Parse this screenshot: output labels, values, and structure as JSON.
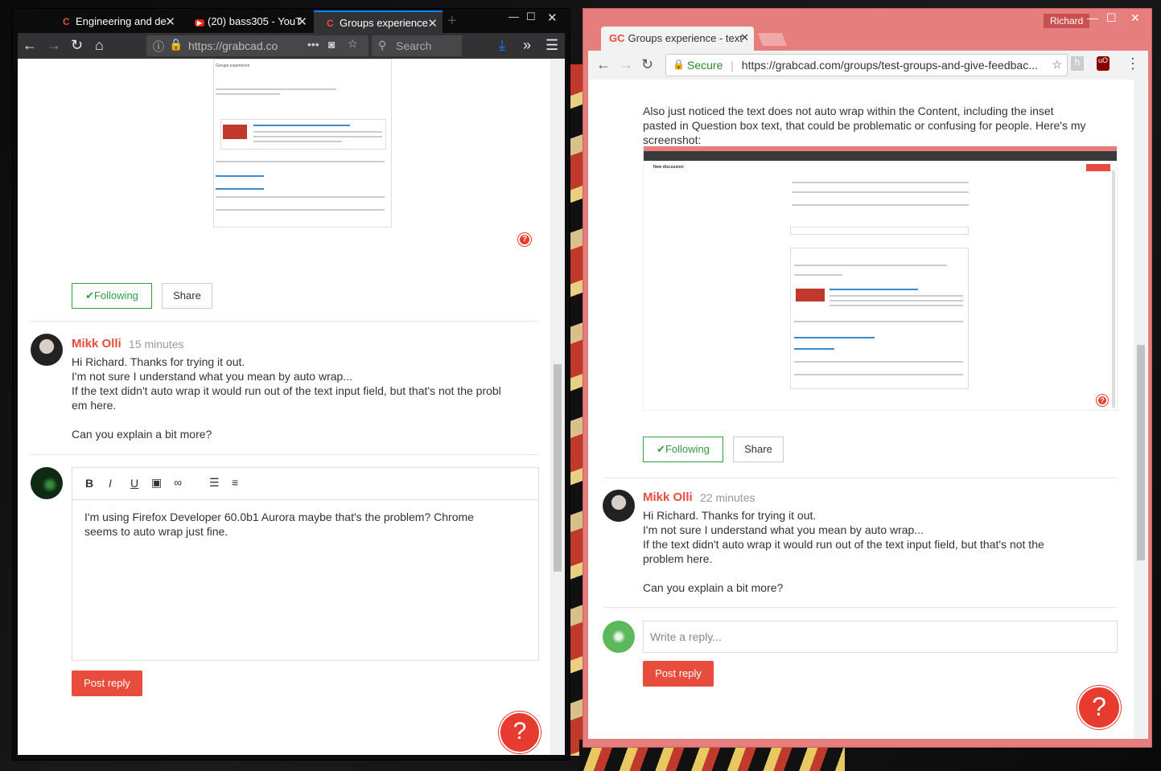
{
  "left": {
    "tabs": [
      {
        "label": "Engineering and de",
        "fav": "C"
      },
      {
        "label": "(20) bass305 - YouT",
        "fav": "▶"
      },
      {
        "label": "Groups experience",
        "fav": "C"
      }
    ],
    "url": "https://grabcad.co",
    "search_placeholder": "Search",
    "thumb_caption": "Groups experience",
    "follow_label": "✔Following",
    "share_label": "Share",
    "comment": {
      "author": "Mikk Olli",
      "time": "15 minutes",
      "lines": [
        "Hi Richard. Thanks for trying it out.",
        "I'm not sure I understand what you mean by auto wrap...",
        "If the text didn't auto wrap it would run out of the text input field, but that's not the probl",
        "em here.",
        "",
        "Can you explain a bit more?"
      ]
    },
    "editor_text_1": "I'm using Firefox Developer 60.0b1 Aurora maybe that's the problem?  Chrome",
    "editor_text_2": "seems to auto wrap just fine.",
    "post_label": "Post reply",
    "help_label": "?"
  },
  "right": {
    "tab_label": "Groups experience - text",
    "tab_fav": "GC",
    "user": "Richard",
    "secure": "Secure",
    "url": "https://grabcad.com/groups/test-groups-and-give-feedbac...",
    "body_lines": [
      "Also just noticed the text does not auto wrap within the Content, including the inset",
      "pasted in Question box text, that could be problematic or confusing for people. Here's my",
      "screenshot:"
    ],
    "shot_title": "New discussion",
    "follow_label": "✔Following",
    "share_label": "Share",
    "comment": {
      "author": "Mikk Olli",
      "time": "22 minutes",
      "lines": [
        "Hi Richard. Thanks for trying it out.",
        "I'm not sure I understand what you mean by auto wrap...",
        "If the text didn't auto wrap it would run out of the text input field, but that's not the",
        "problem here.",
        "",
        "Can you explain a bit more?"
      ]
    },
    "reply_placeholder": "Write a reply...",
    "post_label": "Post reply",
    "help_label": "?"
  }
}
